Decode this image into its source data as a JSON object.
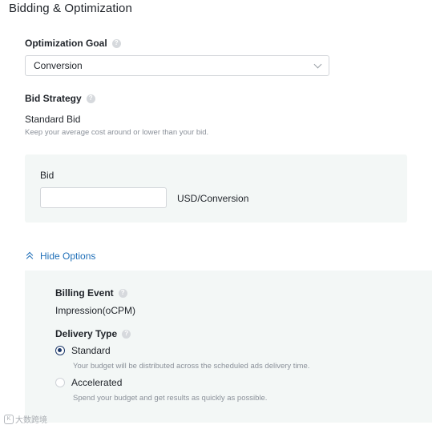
{
  "section_title": "Bidding & Optimization",
  "optimization_goal": {
    "label": "Optimization Goal",
    "selected": "Conversion"
  },
  "bid_strategy": {
    "label": "Bid Strategy",
    "value": "Standard Bid",
    "hint": "Keep your average cost around or lower than your bid."
  },
  "bid": {
    "label": "Bid",
    "input_value": "",
    "unit": "USD/Conversion"
  },
  "toggle_options_label": "Hide Options",
  "billing_event": {
    "label": "Billing Event",
    "value": "Impression(oCPM)"
  },
  "delivery_type": {
    "label": "Delivery Type",
    "options": [
      {
        "label": "Standard",
        "checked": true,
        "hint": "Your budget will be distributed across the scheduled ads delivery time."
      },
      {
        "label": "Accelerated",
        "checked": false,
        "hint": "Spend your budget and get results as quickly as possible."
      }
    ]
  },
  "watermark": {
    "logo_text": "K",
    "text": "大数跨境"
  },
  "colors": {
    "link": "#1f6fb8",
    "panel_bg": "#f3f7f6",
    "radio_checked": "#1e3a6b"
  }
}
